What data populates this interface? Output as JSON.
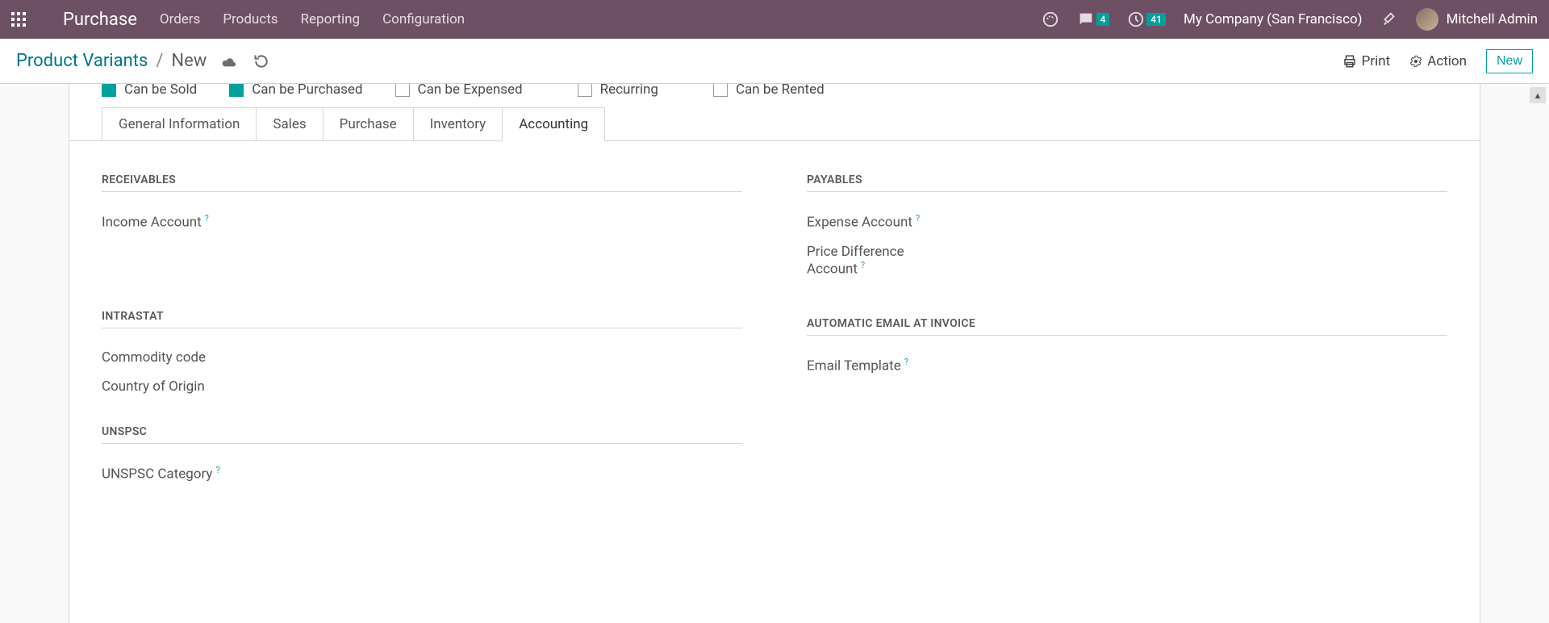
{
  "navbar": {
    "brand": "Purchase",
    "menu": [
      "Orders",
      "Products",
      "Reporting",
      "Configuration"
    ],
    "messages_badge": "4",
    "activities_badge": "41",
    "company": "My Company (San Francisco)",
    "user": "Mitchell Admin"
  },
  "control_panel": {
    "breadcrumb_root": "Product Variants",
    "breadcrumb_sep": "/",
    "breadcrumb_current": "New",
    "print_label": "Print",
    "action_label": "Action",
    "new_label": "New"
  },
  "checks": {
    "can_be_sold": "Can be Sold",
    "can_be_purchased": "Can be Purchased",
    "can_be_expensed": "Can be Expensed",
    "recurring": "Recurring",
    "can_be_rented": "Can be Rented"
  },
  "tabs": {
    "general": "General Information",
    "sales": "Sales",
    "purchase": "Purchase",
    "inventory": "Inventory",
    "accounting": "Accounting"
  },
  "sections": {
    "receivables": "RECEIVABLES",
    "payables": "PAYABLES",
    "intrastat": "INTRASTAT",
    "auto_email": "AUTOMATIC EMAIL AT INVOICE",
    "unspsc": "UNSPSC"
  },
  "fields": {
    "income_account": "Income Account",
    "expense_account": "Expense Account",
    "price_diff_account": "Price Difference Account",
    "commodity_code": "Commodity code",
    "country_origin": "Country of Origin",
    "email_template": "Email Template",
    "unspsc_category": "UNSPSC Category"
  },
  "help": "?"
}
